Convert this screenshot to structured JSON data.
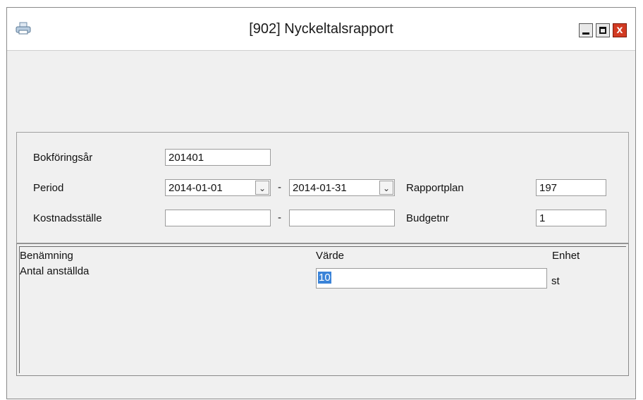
{
  "window": {
    "title": "[902]  Nyckeltalsrapport",
    "icons": {
      "app": "printer-icon",
      "minimize": "minimize-icon",
      "maximize": "maximize-icon",
      "close": "close-icon"
    },
    "close_glyph": "x"
  },
  "filters": {
    "bokforingsar_label": "Bokföringsår",
    "bokforingsar_value": "201401",
    "period_label": "Period",
    "period_from": "2014-01-01",
    "period_to": "2014-01-31",
    "range_dash": "-",
    "rapportplan_label": "Rapportplan",
    "rapportplan_value": "197",
    "kostnadsstalle_label": "Kostnadsställe",
    "kostnadsstalle_from": "",
    "kostnadsstalle_to": "",
    "budgetnr_label": "Budgetnr",
    "budgetnr_value": "1",
    "dropdown_glyph": "⌄"
  },
  "grid": {
    "columns": [
      "Benämning",
      "Värde",
      "Enhet"
    ],
    "rows": [
      {
        "benamning": "Antal anställda",
        "varde": "10",
        "enhet": "st"
      }
    ]
  },
  "colors": {
    "close_button": "#d23a22",
    "selection": "#3a83d8"
  }
}
